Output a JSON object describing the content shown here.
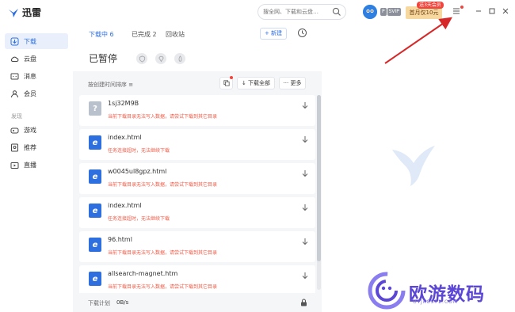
{
  "app": {
    "title": "迅雷"
  },
  "search": {
    "placeholder": "搜全网、下载和云盘…"
  },
  "header": {
    "vip_badge": "P",
    "vip_badge2": "SVIP",
    "promo_tag": "送3天会员",
    "promo_label": "首月仅10元"
  },
  "sidebar": {
    "items": [
      {
        "label": "下载",
        "icon": "download-icon"
      },
      {
        "label": "云盘",
        "icon": "cloud-icon"
      },
      {
        "label": "消息",
        "icon": "message-icon"
      },
      {
        "label": "会员",
        "icon": "member-icon"
      }
    ],
    "section_label": "发现",
    "discover": [
      {
        "label": "游戏",
        "icon": "game-icon"
      },
      {
        "label": "推荐",
        "icon": "recommend-icon"
      },
      {
        "label": "直播",
        "icon": "live-icon"
      }
    ]
  },
  "tabs": [
    {
      "label": "下载中 6",
      "active": true
    },
    {
      "label": "已完成 2",
      "active": false
    },
    {
      "label": "回收站",
      "active": false
    }
  ],
  "toolbar": {
    "new_label": "+ 新建",
    "paused_title": "已暂停",
    "sort_label": "按创建时间排序 ≡",
    "download_all_label": "下载全部",
    "more_label": "··· 更多"
  },
  "tasks": [
    {
      "name": "1sj32M9B",
      "status": "当前下载目录无法写入数据，请尝试下载到其它目录",
      "icon": "unknown-file-icon"
    },
    {
      "name": "index.html",
      "status": "任务连接超时，无法继续下载",
      "icon": "html-file-icon"
    },
    {
      "name": "w0045ul8gpz.html",
      "status": "当前下载目录无法写入数据，请尝试下载到其它目录",
      "icon": "html-file-icon"
    },
    {
      "name": "index.html",
      "status": "任务连接超时，无法继续下载",
      "icon": "html-file-icon"
    },
    {
      "name": "96.html",
      "status": "当前下载目录无法写入数据，请尝试下载到其它目录",
      "icon": "html-file-icon"
    },
    {
      "name": "allsearch-magnet.htm",
      "status": "当前下载目录无法写入数据，请尝试下载到其它目录",
      "icon": "html-file-icon"
    }
  ],
  "footer": {
    "plan_label": "下载计划",
    "speed": "0B/s"
  },
  "brand": {
    "name": "欧游数码",
    "sub": "OYJK8572.COM"
  },
  "colors": {
    "accent": "#2e6fe0",
    "error": "#f05a46",
    "annotation_arrow": "#d62828",
    "brand": "#5b46d6"
  }
}
